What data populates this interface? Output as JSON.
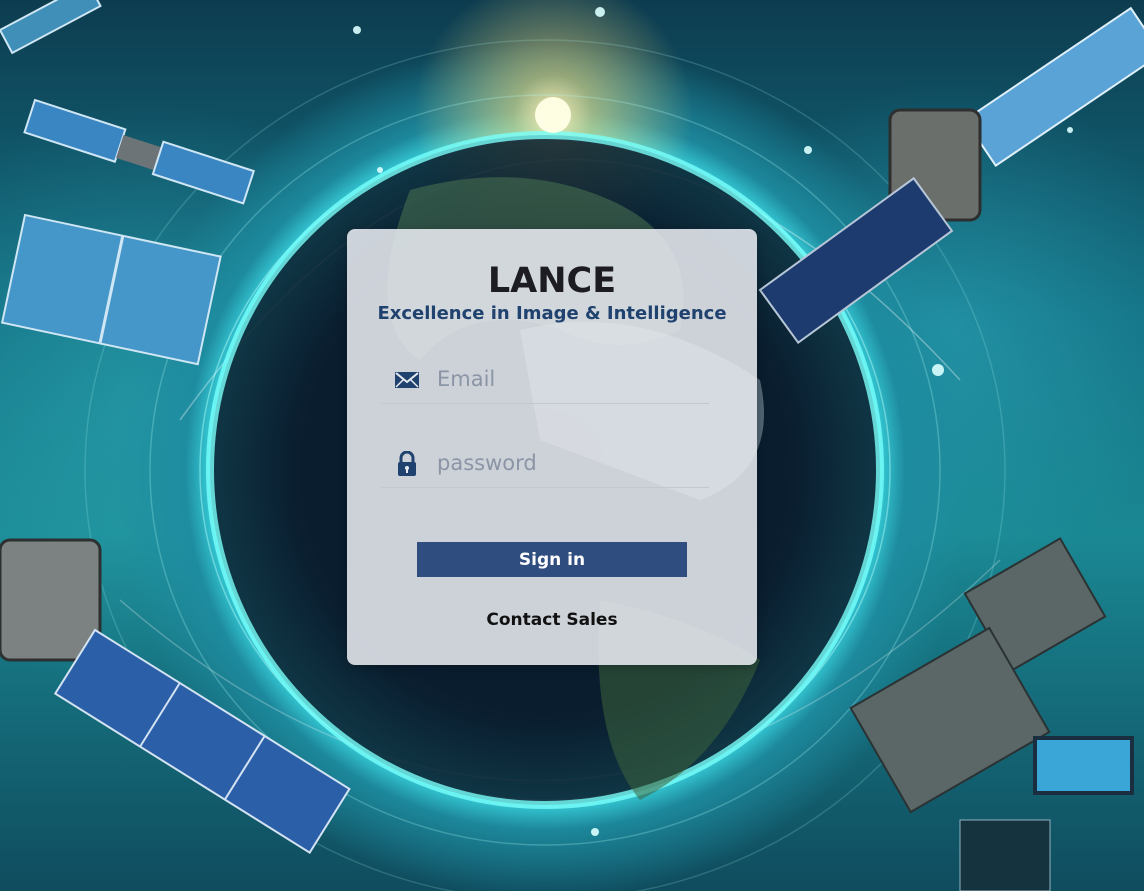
{
  "brand": {
    "title": "LANCE",
    "subtitle": "Excellence in Image & Intelligence"
  },
  "form": {
    "email": {
      "icon": "envelope-icon",
      "placeholder": "Email",
      "value": ""
    },
    "password": {
      "icon": "lock-icon",
      "placeholder": "password",
      "value": ""
    },
    "sign_in_label": "Sign in",
    "contact_label": "Contact Sales"
  },
  "colors": {
    "button": "#2f4d7e",
    "subtitle": "#20426f",
    "card": "#e8ebf0"
  }
}
